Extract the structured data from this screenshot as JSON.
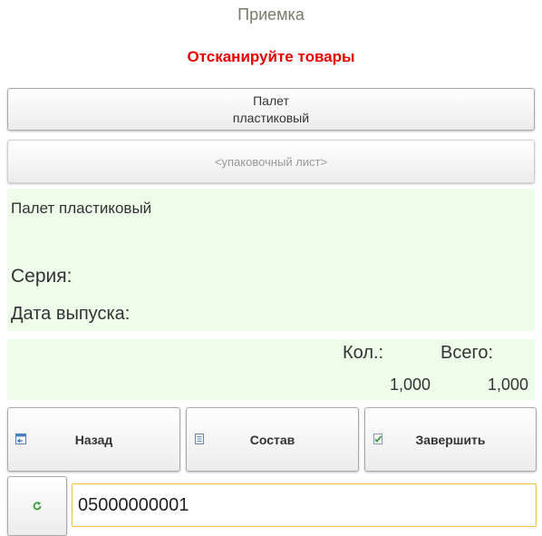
{
  "header": {
    "title": "Приемка",
    "prompt": "Отсканируйте товары"
  },
  "pallet_button": {
    "line1": "Палет",
    "line2": "пластиковый"
  },
  "packing_list_button": {
    "label": "<упаковочный лист>"
  },
  "info": {
    "item_name": "Палет пластиковый",
    "series_label": "Серия:",
    "release_date_label": "Дата выпуска:"
  },
  "quantity": {
    "qty_label": "Кол.:",
    "total_label": "Всего:",
    "qty_value": "1,000",
    "total_value": "1,000"
  },
  "actions": {
    "back_label": "Назад",
    "composition_label": "Состав",
    "finish_label": "Завершить"
  },
  "scan": {
    "value": "05000000001"
  },
  "colors": {
    "prompt": "#e80000",
    "panel_bg": "#eefdea",
    "input_border": "#f2c232",
    "refresh_icon": "#3a9a3a"
  },
  "icons": {
    "back": "back-window-icon",
    "composition": "list-document-icon",
    "finish": "check-document-icon",
    "refresh": "refresh-icon"
  }
}
